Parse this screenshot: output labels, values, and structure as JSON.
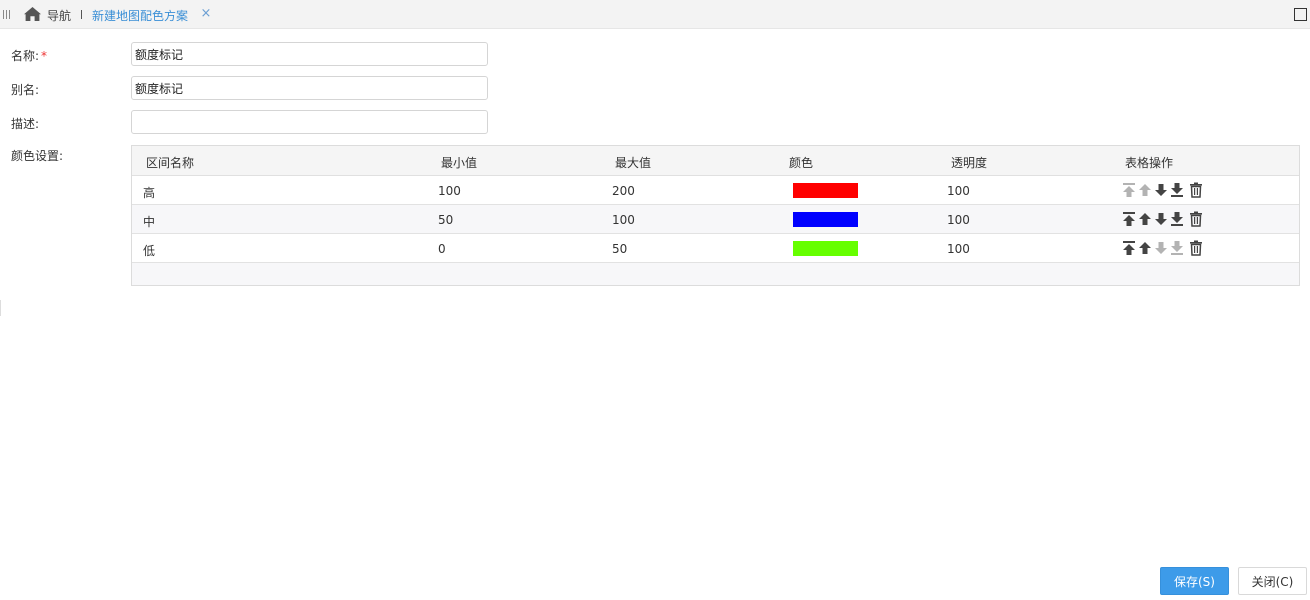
{
  "tabs": {
    "nav_label": "导航",
    "active_tab_label": "新建地图配色方案",
    "close_symbol": "×"
  },
  "form": {
    "name_label": "名称:",
    "required_mark": "*",
    "name_value": "额度标记",
    "alias_label": "别名:",
    "alias_value": "额度标记",
    "desc_label": "描述:",
    "desc_value": "",
    "color_label": "颜色设置:"
  },
  "table": {
    "columns": [
      "区间名称",
      "最小值",
      "最大值",
      "颜色",
      "透明度",
      "表格操作"
    ],
    "rows": [
      {
        "name": "高",
        "min": "100",
        "max": "200",
        "color": "#ff0000",
        "opacity": "100",
        "ops_enabled": [
          false,
          false,
          true,
          true,
          true
        ]
      },
      {
        "name": "中",
        "min": "50",
        "max": "100",
        "color": "#0000ff",
        "opacity": "100",
        "ops_enabled": [
          true,
          true,
          true,
          true,
          true
        ]
      },
      {
        "name": "低",
        "min": "0",
        "max": "50",
        "color": "#66ff00",
        "opacity": "100",
        "ops_enabled": [
          true,
          true,
          false,
          false,
          true
        ]
      }
    ],
    "op_icons": [
      "move-top-icon",
      "move-up-icon",
      "move-down-icon",
      "move-bottom-icon",
      "trash-icon"
    ]
  },
  "buttons": {
    "save": "保存(S)",
    "close": "关闭(C)"
  },
  "colors": {
    "accent": "#3d9be9",
    "tab_active_text": "#3a8fd6",
    "icon_enabled": "#444444",
    "icon_disabled": "#b3b3b3"
  }
}
